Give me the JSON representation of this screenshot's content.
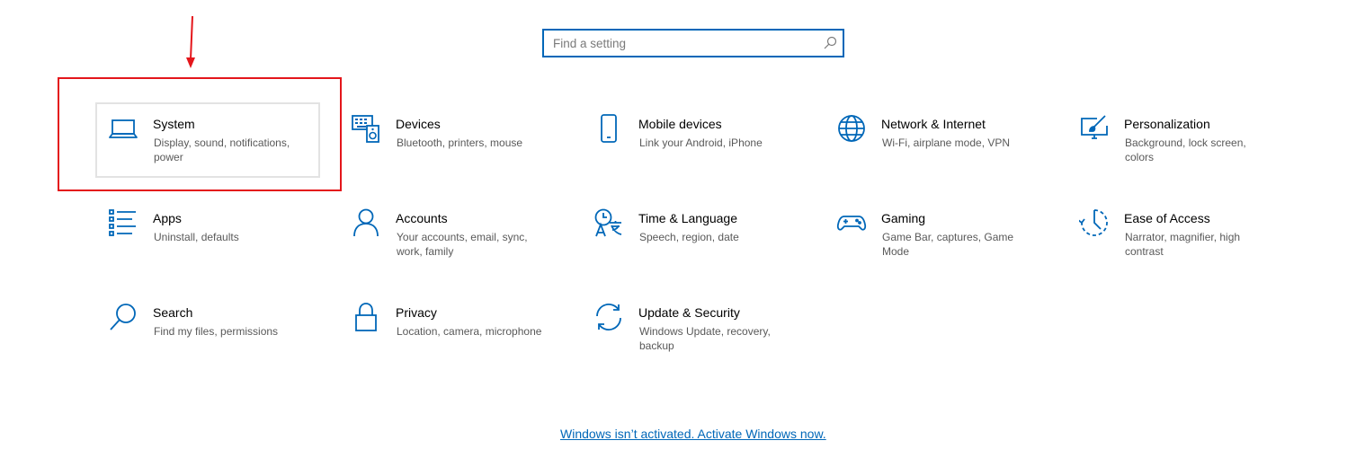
{
  "search": {
    "placeholder": "Find a setting",
    "value": ""
  },
  "tiles": [
    {
      "title": "System",
      "desc": "Display, sound, notifications, power",
      "icon": "laptop-icon"
    },
    {
      "title": "Devices",
      "desc": "Bluetooth, printers, mouse",
      "icon": "devices-icon"
    },
    {
      "title": "Mobile devices",
      "desc": "Link your Android, iPhone",
      "icon": "phone-icon"
    },
    {
      "title": "Network & Internet",
      "desc": "Wi-Fi, airplane mode, VPN",
      "icon": "globe-icon"
    },
    {
      "title": "Personalization",
      "desc": "Background, lock screen, colors",
      "icon": "paintbrush-icon"
    },
    {
      "title": "Apps",
      "desc": "Uninstall, defaults",
      "icon": "apps-list-icon"
    },
    {
      "title": "Accounts",
      "desc": "Your accounts, email, sync, work, family",
      "icon": "person-icon"
    },
    {
      "title": "Time & Language",
      "desc": "Speech, region, date",
      "icon": "time-language-icon"
    },
    {
      "title": "Gaming",
      "desc": "Game Bar, captures, Game Mode",
      "icon": "gamepad-icon"
    },
    {
      "title": "Ease of Access",
      "desc": "Narrator, magnifier, high contrast",
      "icon": "ease-of-access-icon"
    },
    {
      "title": "Search",
      "desc": "Find my files, permissions",
      "icon": "search-icon"
    },
    {
      "title": "Privacy",
      "desc": "Location, camera, microphone",
      "icon": "lock-icon"
    },
    {
      "title": "Update & Security",
      "desc": "Windows Update, recovery, backup",
      "icon": "sync-icon"
    }
  ],
  "activation": {
    "link_text": "Windows isn’t activated. Activate Windows now."
  },
  "colors": {
    "accent": "#0067b8",
    "annotation": "#e4161b",
    "secondary_text": "#595959"
  }
}
